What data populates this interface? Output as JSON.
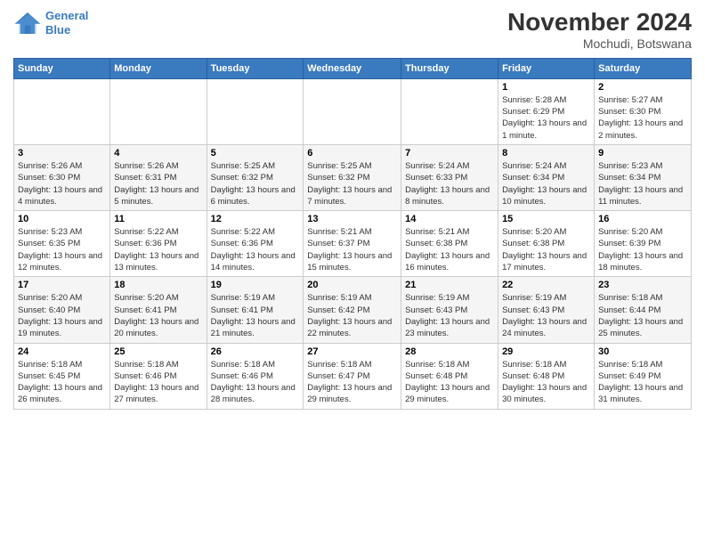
{
  "logo": {
    "line1": "General",
    "line2": "Blue"
  },
  "title": "November 2024",
  "subtitle": "Mochudi, Botswana",
  "days": [
    "Sunday",
    "Monday",
    "Tuesday",
    "Wednesday",
    "Thursday",
    "Friday",
    "Saturday"
  ],
  "weeks": [
    [
      {
        "num": "",
        "detail": ""
      },
      {
        "num": "",
        "detail": ""
      },
      {
        "num": "",
        "detail": ""
      },
      {
        "num": "",
        "detail": ""
      },
      {
        "num": "",
        "detail": ""
      },
      {
        "num": "1",
        "detail": "Sunrise: 5:28 AM\nSunset: 6:29 PM\nDaylight: 13 hours and 1 minute."
      },
      {
        "num": "2",
        "detail": "Sunrise: 5:27 AM\nSunset: 6:30 PM\nDaylight: 13 hours and 2 minutes."
      }
    ],
    [
      {
        "num": "3",
        "detail": "Sunrise: 5:26 AM\nSunset: 6:30 PM\nDaylight: 13 hours and 4 minutes."
      },
      {
        "num": "4",
        "detail": "Sunrise: 5:26 AM\nSunset: 6:31 PM\nDaylight: 13 hours and 5 minutes."
      },
      {
        "num": "5",
        "detail": "Sunrise: 5:25 AM\nSunset: 6:32 PM\nDaylight: 13 hours and 6 minutes."
      },
      {
        "num": "6",
        "detail": "Sunrise: 5:25 AM\nSunset: 6:32 PM\nDaylight: 13 hours and 7 minutes."
      },
      {
        "num": "7",
        "detail": "Sunrise: 5:24 AM\nSunset: 6:33 PM\nDaylight: 13 hours and 8 minutes."
      },
      {
        "num": "8",
        "detail": "Sunrise: 5:24 AM\nSunset: 6:34 PM\nDaylight: 13 hours and 10 minutes."
      },
      {
        "num": "9",
        "detail": "Sunrise: 5:23 AM\nSunset: 6:34 PM\nDaylight: 13 hours and 11 minutes."
      }
    ],
    [
      {
        "num": "10",
        "detail": "Sunrise: 5:23 AM\nSunset: 6:35 PM\nDaylight: 13 hours and 12 minutes."
      },
      {
        "num": "11",
        "detail": "Sunrise: 5:22 AM\nSunset: 6:36 PM\nDaylight: 13 hours and 13 minutes."
      },
      {
        "num": "12",
        "detail": "Sunrise: 5:22 AM\nSunset: 6:36 PM\nDaylight: 13 hours and 14 minutes."
      },
      {
        "num": "13",
        "detail": "Sunrise: 5:21 AM\nSunset: 6:37 PM\nDaylight: 13 hours and 15 minutes."
      },
      {
        "num": "14",
        "detail": "Sunrise: 5:21 AM\nSunset: 6:38 PM\nDaylight: 13 hours and 16 minutes."
      },
      {
        "num": "15",
        "detail": "Sunrise: 5:20 AM\nSunset: 6:38 PM\nDaylight: 13 hours and 17 minutes."
      },
      {
        "num": "16",
        "detail": "Sunrise: 5:20 AM\nSunset: 6:39 PM\nDaylight: 13 hours and 18 minutes."
      }
    ],
    [
      {
        "num": "17",
        "detail": "Sunrise: 5:20 AM\nSunset: 6:40 PM\nDaylight: 13 hours and 19 minutes."
      },
      {
        "num": "18",
        "detail": "Sunrise: 5:20 AM\nSunset: 6:41 PM\nDaylight: 13 hours and 20 minutes."
      },
      {
        "num": "19",
        "detail": "Sunrise: 5:19 AM\nSunset: 6:41 PM\nDaylight: 13 hours and 21 minutes."
      },
      {
        "num": "20",
        "detail": "Sunrise: 5:19 AM\nSunset: 6:42 PM\nDaylight: 13 hours and 22 minutes."
      },
      {
        "num": "21",
        "detail": "Sunrise: 5:19 AM\nSunset: 6:43 PM\nDaylight: 13 hours and 23 minutes."
      },
      {
        "num": "22",
        "detail": "Sunrise: 5:19 AM\nSunset: 6:43 PM\nDaylight: 13 hours and 24 minutes."
      },
      {
        "num": "23",
        "detail": "Sunrise: 5:18 AM\nSunset: 6:44 PM\nDaylight: 13 hours and 25 minutes."
      }
    ],
    [
      {
        "num": "24",
        "detail": "Sunrise: 5:18 AM\nSunset: 6:45 PM\nDaylight: 13 hours and 26 minutes."
      },
      {
        "num": "25",
        "detail": "Sunrise: 5:18 AM\nSunset: 6:46 PM\nDaylight: 13 hours and 27 minutes."
      },
      {
        "num": "26",
        "detail": "Sunrise: 5:18 AM\nSunset: 6:46 PM\nDaylight: 13 hours and 28 minutes."
      },
      {
        "num": "27",
        "detail": "Sunrise: 5:18 AM\nSunset: 6:47 PM\nDaylight: 13 hours and 29 minutes."
      },
      {
        "num": "28",
        "detail": "Sunrise: 5:18 AM\nSunset: 6:48 PM\nDaylight: 13 hours and 29 minutes."
      },
      {
        "num": "29",
        "detail": "Sunrise: 5:18 AM\nSunset: 6:48 PM\nDaylight: 13 hours and 30 minutes."
      },
      {
        "num": "30",
        "detail": "Sunrise: 5:18 AM\nSunset: 6:49 PM\nDaylight: 13 hours and 31 minutes."
      }
    ]
  ]
}
